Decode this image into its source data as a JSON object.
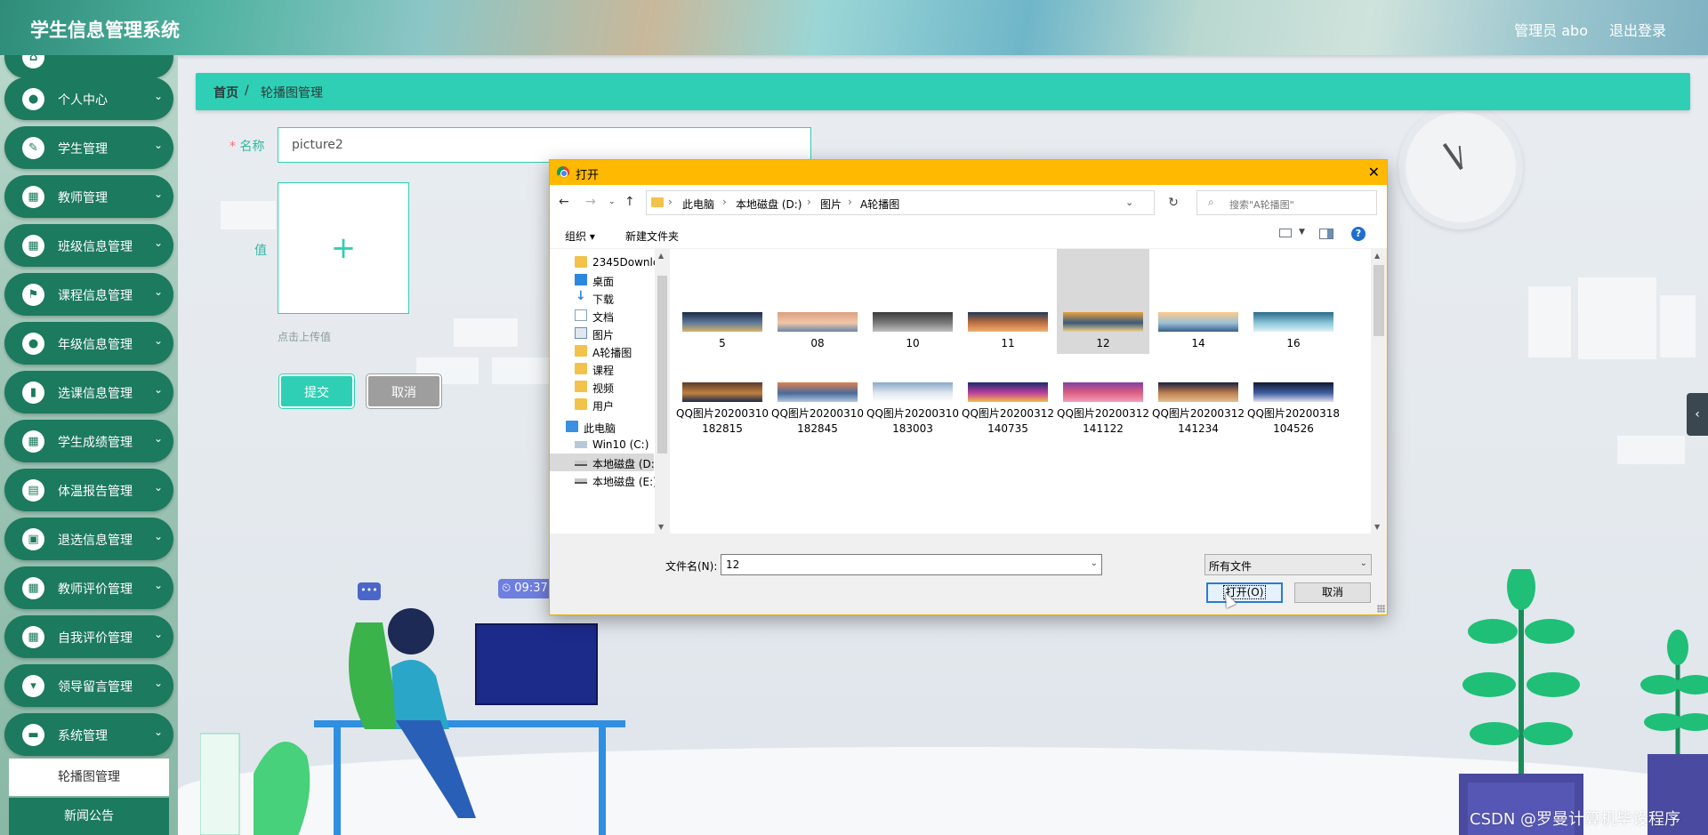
{
  "header": {
    "title": "学生信息管理系统",
    "user": "管理员 abo",
    "logout": "退出登录"
  },
  "sidebar": {
    "items": [
      {
        "label": "个人中心",
        "icon": "person-icon"
      },
      {
        "label": "学生管理",
        "icon": "student-icon"
      },
      {
        "label": "教师管理",
        "icon": "grid-icon"
      },
      {
        "label": "班级信息管理",
        "icon": "grid-icon"
      },
      {
        "label": "课程信息管理",
        "icon": "flag-icon"
      },
      {
        "label": "年级信息管理",
        "icon": "person-icon"
      },
      {
        "label": "选课信息管理",
        "icon": "chart-icon"
      },
      {
        "label": "学生成绩管理",
        "icon": "grid-icon"
      },
      {
        "label": "体温报告管理",
        "icon": "book-icon"
      },
      {
        "label": "退选信息管理",
        "icon": "briefcase-icon"
      },
      {
        "label": "教师评价管理",
        "icon": "grid-icon"
      },
      {
        "label": "自我评价管理",
        "icon": "grid-icon"
      },
      {
        "label": "领导留言管理",
        "icon": "podium-icon"
      },
      {
        "label": "系统管理",
        "icon": "chat-icon"
      }
    ],
    "sub_active": "轮播图管理",
    "sub_next": "新闻公告"
  },
  "breadcrumb": {
    "home": "首页",
    "sep": "/",
    "current": "轮播图管理"
  },
  "form": {
    "name_label": "名称",
    "name_value": "picture2",
    "value_label": "值",
    "upload_hint": "点击上传值",
    "submit": "提交",
    "cancel": "取消"
  },
  "time_badge": "09:37",
  "watermark": "CSDN @罗曼计算机毕设程序",
  "dialog": {
    "title": "打开",
    "path": [
      "此电脑",
      "本地磁盘 (D:)",
      "图片",
      "A轮播图"
    ],
    "search_placeholder": "搜索\"A轮播图\"",
    "organize": "组织 ▾",
    "new_folder": "新建文件夹",
    "tree": [
      {
        "label": "2345Downlc",
        "icon": "folder",
        "pin": true
      },
      {
        "label": "桌面",
        "icon": "desk",
        "pin": true
      },
      {
        "label": "下载",
        "icon": "down",
        "pin": true
      },
      {
        "label": "文档",
        "icon": "doc",
        "pin": true
      },
      {
        "label": "图片",
        "icon": "pic",
        "pin": true
      },
      {
        "label": "A轮播图",
        "icon": "folder",
        "pin": false
      },
      {
        "label": "课程",
        "icon": "folder",
        "pin": false
      },
      {
        "label": "视频",
        "icon": "folder",
        "pin": false
      },
      {
        "label": "用户",
        "icon": "folder",
        "pin": false
      },
      {
        "label": "此电脑",
        "icon": "pc",
        "pin": false
      },
      {
        "label": "Win10 (C:)",
        "icon": "win",
        "pin": false
      },
      {
        "label": "本地磁盘 (D:)",
        "icon": "drive",
        "pin": false
      },
      {
        "label": "本地磁盘 (E:)",
        "icon": "drive",
        "pin": false
      }
    ],
    "files_row1": [
      "5",
      "08",
      "10",
      "11",
      "12",
      "14",
      "16"
    ],
    "files_row2": [
      "QQ图片20200310182815",
      "QQ图片20200310182845",
      "QQ图片20200310183003",
      "QQ图片20200312140735",
      "QQ图片20200312141122",
      "QQ图片20200312141234",
      "QQ图片20200318104526"
    ],
    "selected_file": "12",
    "filename_label": "文件名(N):",
    "filename_value": "12",
    "filetype": "所有文件",
    "open_label": "打开(O)",
    "cancel_label": "取消",
    "colors": {
      "title_bar": "#ffb900",
      "selection": "#d9d9d9"
    }
  },
  "colors": {
    "accent": "#2fcfb5",
    "nav": "#1c7a5e",
    "cancel": "#9e9e9e"
  }
}
